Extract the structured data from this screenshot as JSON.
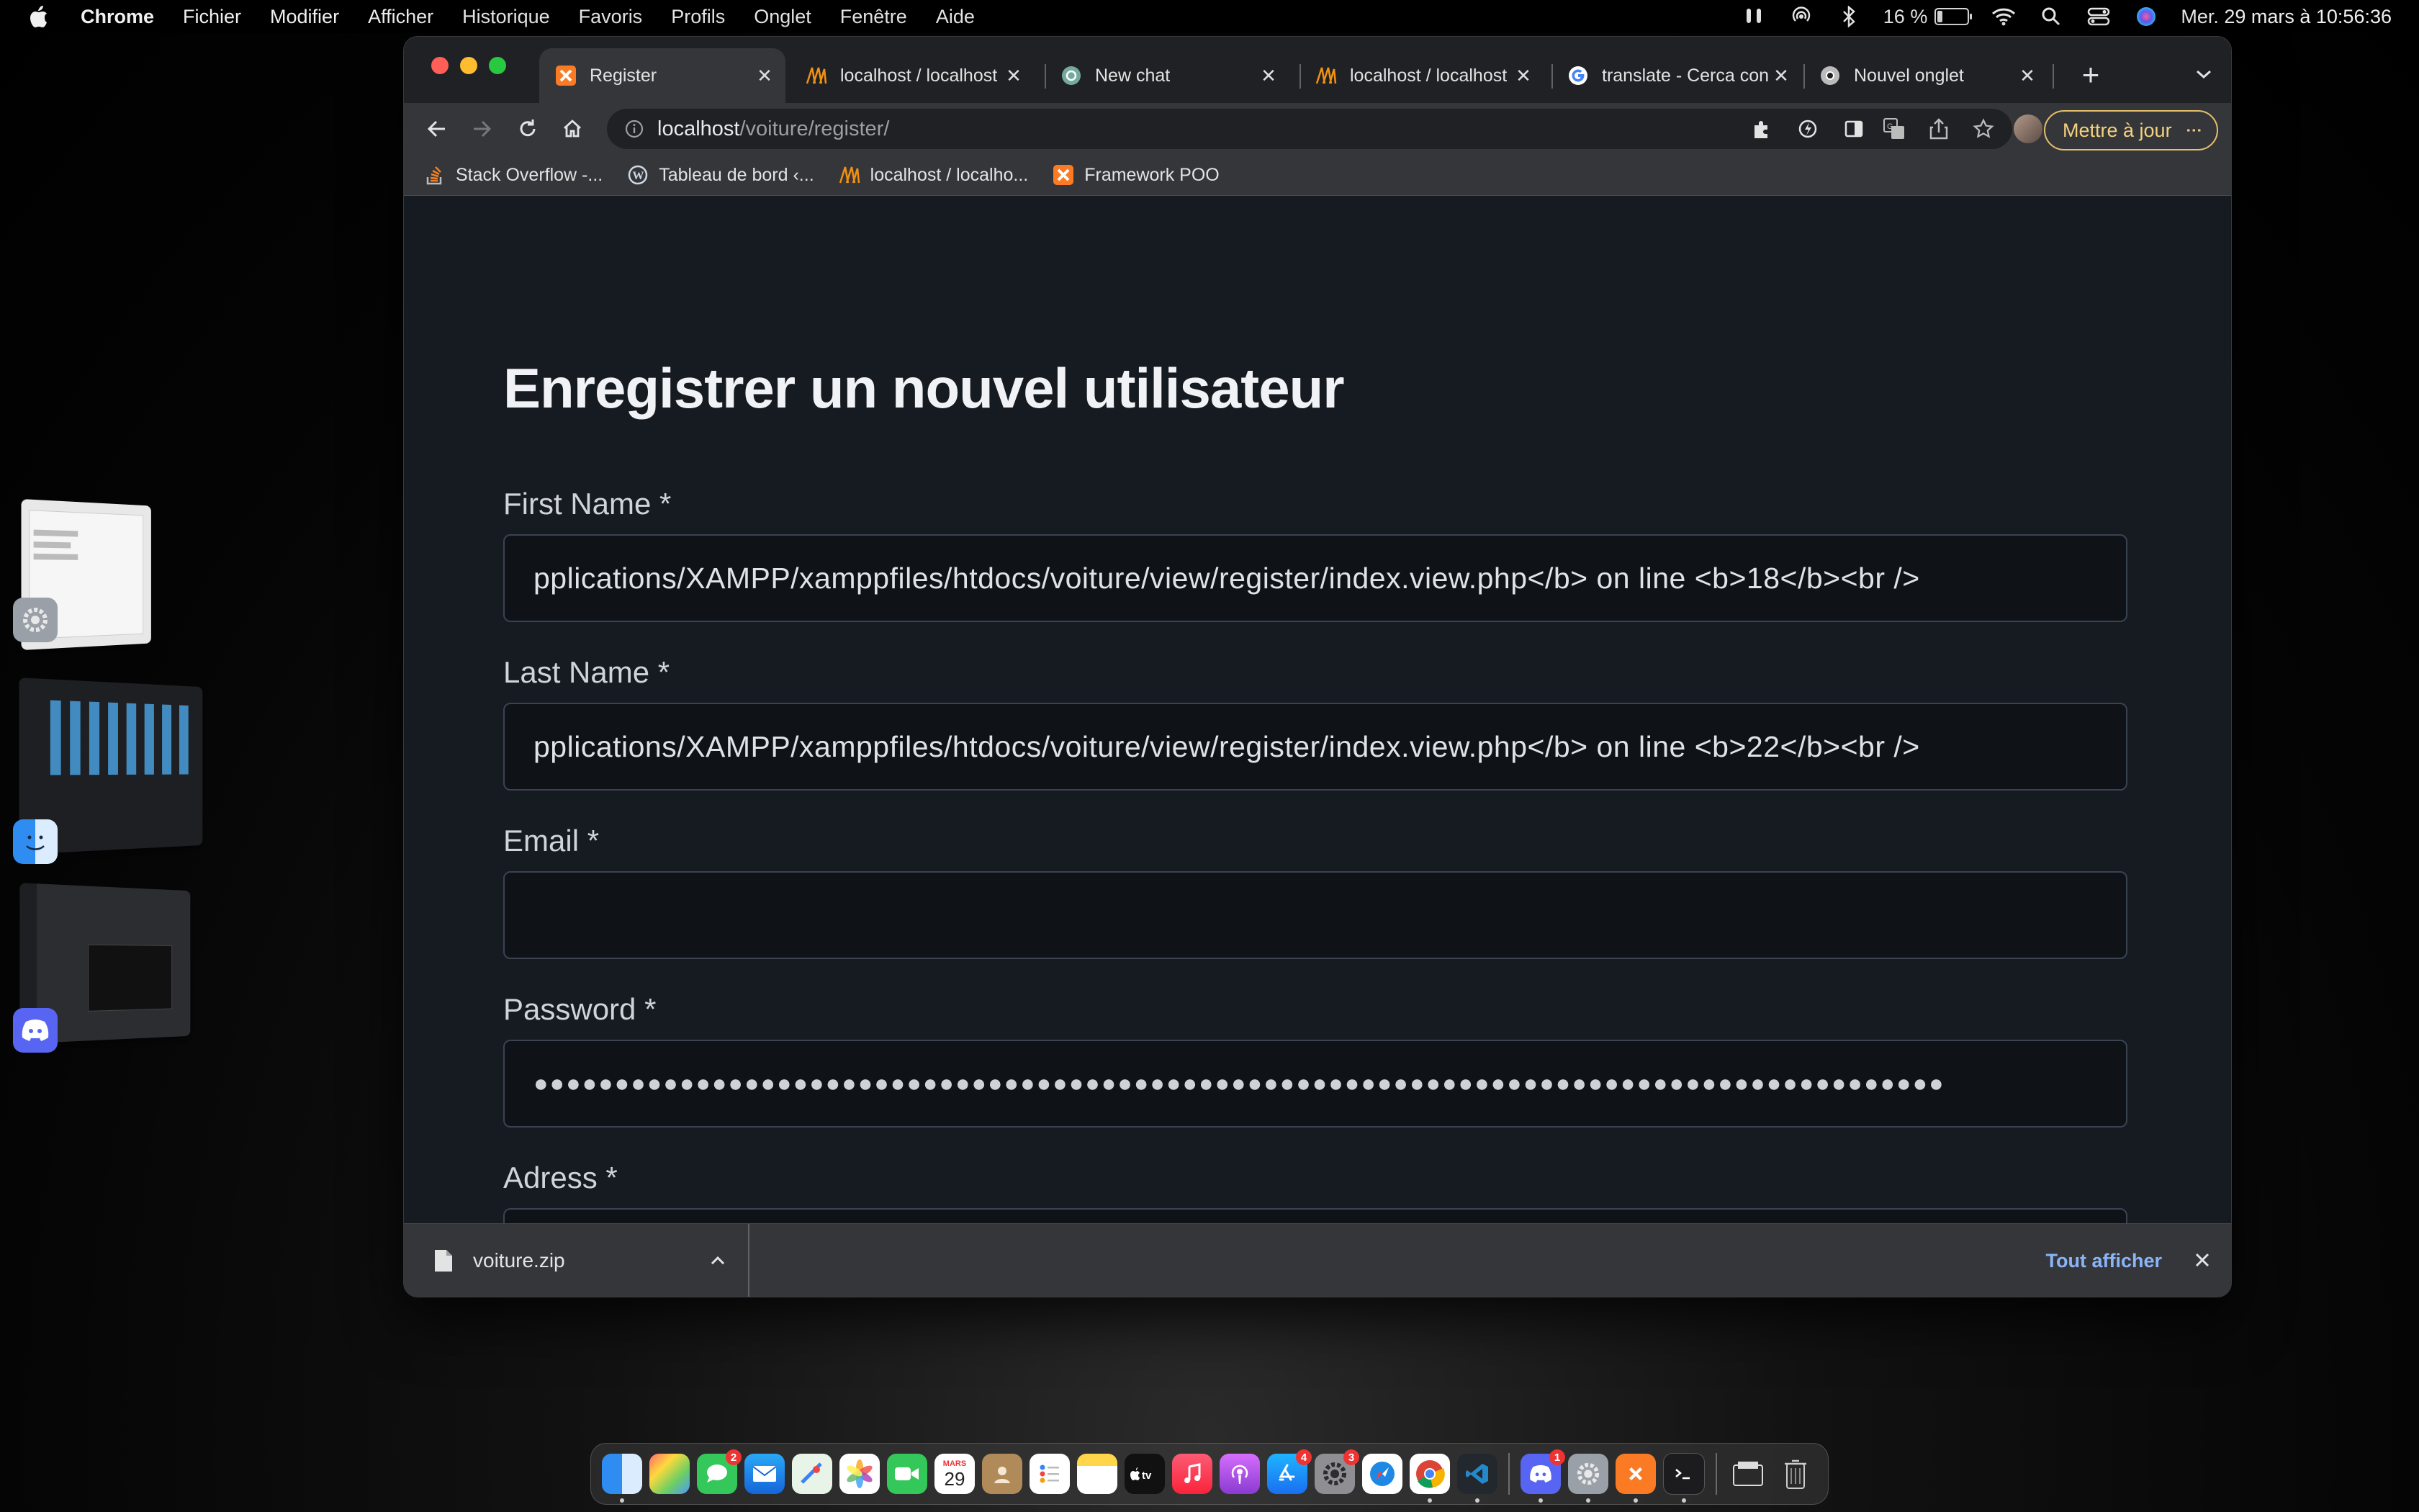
{
  "menubar": {
    "app": "Chrome",
    "items": [
      "Fichier",
      "Modifier",
      "Afficher",
      "Historique",
      "Favoris",
      "Profils",
      "Onglet",
      "Fenêtre",
      "Aide"
    ],
    "battery": "16 %",
    "datetime": "Mer. 29 mars à 10:56:36"
  },
  "tabs": [
    {
      "label": "Register",
      "icon": "xampp-icon",
      "active": true
    },
    {
      "label": "localhost / localhost",
      "icon": "phpmyadmin-icon"
    },
    {
      "label": "New chat",
      "icon": "openai-icon"
    },
    {
      "label": "localhost / localhost",
      "icon": "phpmyadmin-icon"
    },
    {
      "label": "translate - Cerca con",
      "icon": "google-icon"
    },
    {
      "label": "Nouvel onglet",
      "icon": "chrome-icon"
    }
  ],
  "toolbar": {
    "url_host": "localhost",
    "url_path": "/voiture/register/",
    "update_label": "Mettre à jour"
  },
  "bookmarks": [
    {
      "label": "Stack Overflow -...",
      "icon": "stackoverflow-icon"
    },
    {
      "label": "Tableau de bord ‹...",
      "icon": "wordpress-icon"
    },
    {
      "label": "localhost / localho...",
      "icon": "phpmyadmin-icon"
    },
    {
      "label": "Framework POO",
      "icon": "xampp-icon"
    }
  ],
  "page": {
    "title": "Enregistrer un nouvel utilisateur",
    "fields": {
      "first_name": {
        "label": "First Name *",
        "value": "pplications/XAMPP/xamppfiles/htdocs/voiture/view/register/index.view.php</b> on line <b>18</b><br />"
      },
      "last_name": {
        "label": "Last Name *",
        "value": "pplications/XAMPP/xamppfiles/htdocs/voiture/view/register/index.view.php</b> on line <b>22</b><br />"
      },
      "email": {
        "label": "Email *",
        "value": ""
      },
      "password": {
        "label": "Password *",
        "value": "●●●●●●●●●●●●●●●●●●●●●●●●●●●●●●●●●●●●●●●●●●●●●●●●●●●●●●●●●●●●●●●●●●●●●●●●●●●●●●●●●●●●●●●"
      },
      "address": {
        "label": "Adress *"
      }
    }
  },
  "downloads": {
    "file": "voiture.zip",
    "show_all": "Tout afficher"
  },
  "dock": {
    "calendar_day": "29",
    "calendar_month": "MARS",
    "badges": {
      "messages": "2",
      "appstore": "4",
      "settings": "3",
      "discord": "1"
    }
  },
  "colors": {
    "page_bg": "#161b22",
    "input_bg": "#0f1318",
    "update_accent": "#e6c06a",
    "link_blue": "#8ab4f8"
  }
}
